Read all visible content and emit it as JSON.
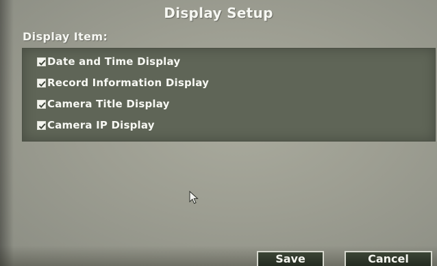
{
  "dialog": {
    "title": "Display Setup"
  },
  "section": {
    "label": "Display Item:"
  },
  "display_items": [
    {
      "label": "Date and Time Display",
      "checked": true
    },
    {
      "label": "Record Information Display",
      "checked": true
    },
    {
      "label": "Camera Title Display",
      "checked": true
    },
    {
      "label": "Camera IP Display",
      "checked": true
    }
  ],
  "buttons": {
    "save_label": "Save",
    "cancel_label": "Cancel"
  },
  "icons": {
    "checkbox": "checkbox-checked-icon",
    "cursor": "mouse-pointer-icon"
  },
  "colors": {
    "panel": "#5f6557",
    "background": "#a3a597",
    "text": "#f6f7f2",
    "button": "#2e3629"
  }
}
